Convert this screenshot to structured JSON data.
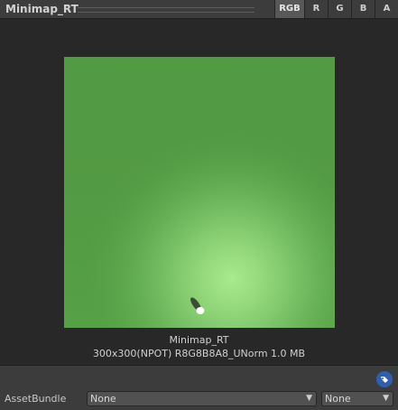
{
  "header": {
    "title": "Minimap_RT",
    "channels": [
      {
        "label": "RGB",
        "active": true
      },
      {
        "label": "R",
        "active": false
      },
      {
        "label": "G",
        "active": false
      },
      {
        "label": "B",
        "active": false
      },
      {
        "label": "A",
        "active": false
      }
    ]
  },
  "preview": {
    "name": "Minimap_RT",
    "info": "300x300(NPOT)  R8G8B8A8_UNorm  1.0 MB",
    "colors": {
      "base": "#56a046",
      "highlight": "#a8ea8e",
      "shade": "#4a8a3c"
    }
  },
  "footer": {
    "assetbundle_label": "AssetBundle",
    "bundle_value": "None",
    "variant_value": "None",
    "tag_icon": "tag-icon"
  }
}
